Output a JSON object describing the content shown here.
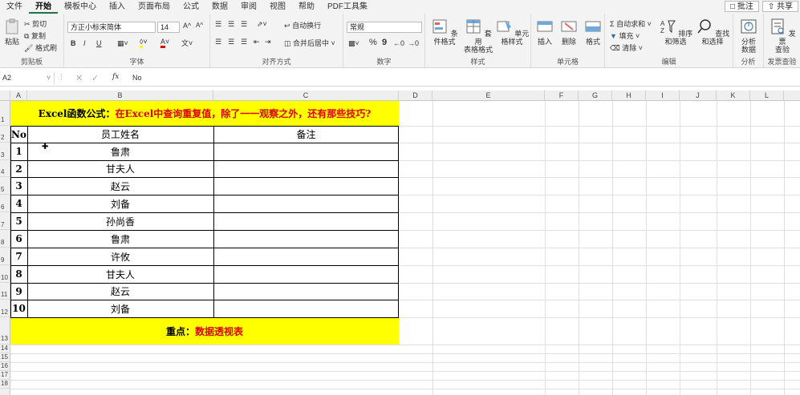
{
  "menu": {
    "tabs": [
      "文件",
      "开始",
      "模板中心",
      "插入",
      "页面布局",
      "公式",
      "数据",
      "审阅",
      "视图",
      "帮助",
      "PDF工具集"
    ],
    "active_tab": "开始",
    "comment_btn": "批注",
    "share_btn": "共享"
  },
  "ribbon": {
    "clipboard": {
      "paste": "粘贴",
      "cut": "剪切",
      "copy": "复制",
      "format_painter": "格式刷",
      "label": "剪贴板"
    },
    "font": {
      "font_name": "方正小标宋简体",
      "font_size": "14",
      "bold": "B",
      "italic": "I",
      "underline": "U",
      "grow": "A^",
      "shrink": "A^",
      "label": "字体"
    },
    "alignment": {
      "wrap": "自动换行",
      "merge": "合并后居中",
      "label": "对齐方式"
    },
    "number": {
      "format": "常规",
      "percent": "%",
      "comma": "9",
      "label": "数字"
    },
    "styles": {
      "cond": "条件格式",
      "table": "套用\n表格格式",
      "cell": "单元格样式",
      "label": "样式"
    },
    "cells": {
      "insert": "插入",
      "delete": "删除",
      "format": "格式",
      "label": "单元格"
    },
    "editing": {
      "autosum": "自动求和",
      "fill": "填充",
      "clear": "清除",
      "sort": "排序和筛选",
      "find": "查找和选择",
      "label": "编辑"
    },
    "analysis": {
      "analyze": "分析\n数据",
      "label": "分析"
    },
    "invoice": {
      "check": "发票\n查验",
      "label": "发票查验"
    }
  },
  "formula_bar": {
    "name_box": "A2",
    "fx": "fx",
    "value": "No"
  },
  "columns": [
    "A",
    "B",
    "C",
    "D",
    "E",
    "F",
    "G",
    "H",
    "I",
    "J",
    "K",
    "L"
  ],
  "rows": [
    "1",
    "2",
    "3",
    "4",
    "5",
    "6",
    "7",
    "8",
    "9",
    "10",
    "11",
    "12",
    "13",
    "14",
    "15",
    "16",
    "17",
    "18"
  ],
  "sheet": {
    "title_black": "Excel函数公式：",
    "title_red": "在Excel中查询重复值，除了一一观察之外，还有那些技巧?",
    "header": {
      "no": "No",
      "name": "员工姓名",
      "note": "备注"
    },
    "records": [
      {
        "no": "1",
        "name": "鲁肃"
      },
      {
        "no": "2",
        "name": "甘夫人"
      },
      {
        "no": "3",
        "name": "赵云"
      },
      {
        "no": "4",
        "name": "刘备"
      },
      {
        "no": "5",
        "name": "孙尚香"
      },
      {
        "no": "6",
        "name": "鲁肃"
      },
      {
        "no": "7",
        "name": "许攸"
      },
      {
        "no": "8",
        "name": "甘夫人"
      },
      {
        "no": "9",
        "name": "赵云"
      },
      {
        "no": "10",
        "name": "刘备"
      }
    ],
    "footer_black": "重点：",
    "footer_red": "数据透视表"
  },
  "colors": {
    "highlight": "#ffff00",
    "accent": "#217346",
    "red": "#e00000"
  }
}
